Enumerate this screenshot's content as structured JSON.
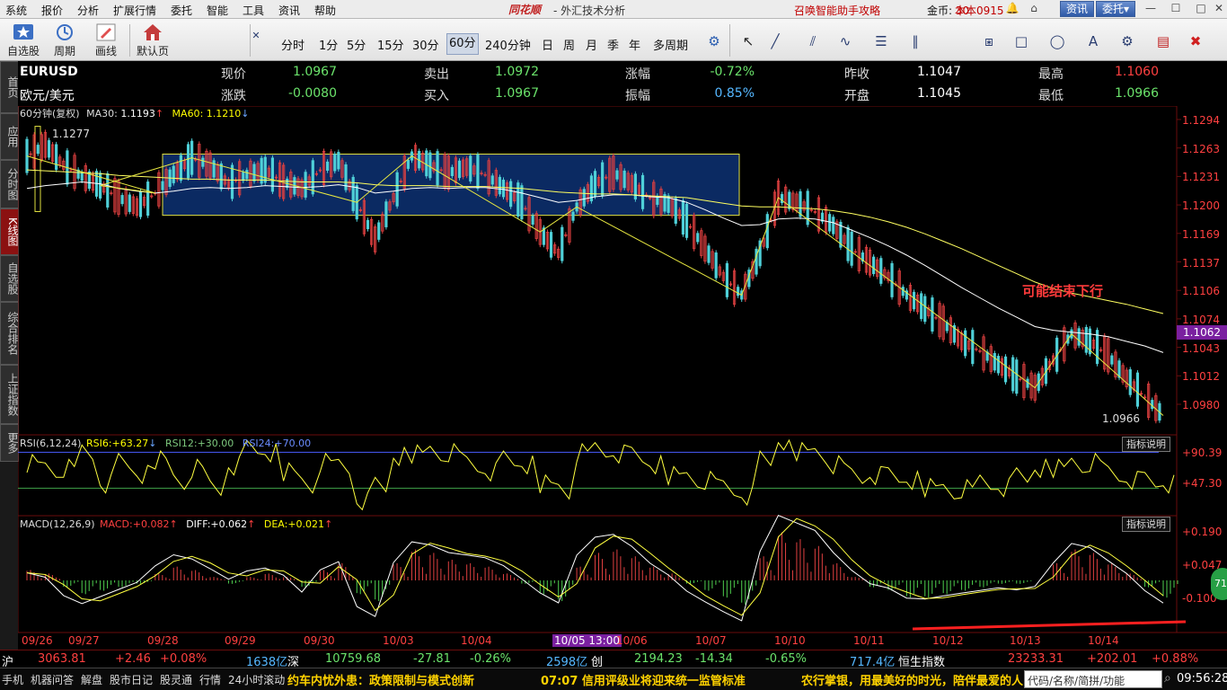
{
  "menu": {
    "items": [
      "系统",
      "报价",
      "分析",
      "扩展行情",
      "委托",
      "智能",
      "工具",
      "资讯",
      "帮助"
    ],
    "brand": "同花顺",
    "brand_subtitle": "- 外汇技术分析",
    "promo": "召唤智能助手攻略",
    "coins_label": "金币:",
    "coins_value": "30",
    "account": "本本0915",
    "btn_info": "资讯",
    "btn_trade": "委托"
  },
  "toolbar": {
    "buttons": [
      {
        "label": "自选股",
        "icon": "star-icon"
      },
      {
        "label": "周期",
        "icon": "cycle-icon"
      },
      {
        "label": "画线",
        "icon": "pen-icon"
      },
      {
        "label": "默认页",
        "icon": "home-icon"
      }
    ],
    "periods": [
      "分时",
      "1分",
      "5分",
      "15分",
      "30分",
      "60分",
      "240分钟",
      "日",
      "周",
      "月",
      "季",
      "年",
      "多周期"
    ],
    "selected_period": "60分",
    "draw_tools": [
      "cursor-icon",
      "line-icon",
      "parallel-icon",
      "wave-icon",
      "fib-icon",
      "bars-icon",
      "channel-icon",
      "rect-icon",
      "ellipse-icon",
      "text-icon",
      "settings-icon",
      "color-icon",
      "delete-icon"
    ]
  },
  "rail": {
    "tabs": [
      {
        "label": "首页",
        "selected": false
      },
      {
        "label": "应用",
        "selected": false
      },
      {
        "label": "分时图",
        "selected": false
      },
      {
        "label": "K线图",
        "selected": true
      },
      {
        "label": "自选股",
        "selected": false
      },
      {
        "label": "综合排名",
        "selected": false
      },
      {
        "label": "上证指数",
        "selected": false
      },
      {
        "label": "更多",
        "selected": false
      }
    ]
  },
  "quote": {
    "symbol": "EURUSD",
    "name": "欧元/美元",
    "rows": [
      {
        "k1": "现价",
        "v1": "1.0967",
        "k2": "卖出",
        "v2": "1.0972",
        "k3": "涨幅",
        "v3": "-0.72%",
        "k4": "昨收",
        "v4": "1.1047",
        "k5": "最高",
        "v5": "1.1060"
      },
      {
        "k1": "涨跌",
        "v1": "-0.0080",
        "k2": "买入",
        "v2": "1.0967",
        "k3": "振幅",
        "v3": "0.85%",
        "k4": "开盘",
        "v4": "1.1045",
        "k5": "最低",
        "v5": "1.0966"
      }
    ]
  },
  "chart_data": [
    {
      "type": "candlestick",
      "title": "60分钟(复权)",
      "indicators": [
        {
          "name": "MA30",
          "value": "1.1193",
          "dir": "↑",
          "color": "#ffffff"
        },
        {
          "name": "MA60",
          "value": "1.1210",
          "dir": "↓",
          "color": "#ffff00"
        }
      ],
      "y_ticks": [
        "1.1294",
        "1.1263",
        "1.1231",
        "1.1200",
        "1.1169",
        "1.1137",
        "1.1106",
        "1.1074",
        "1.1043",
        "1.1012",
        "1.0980"
      ],
      "ylim": [
        1.0955,
        1.13
      ],
      "current_price_label": "1.1062",
      "high_label": "1.1277",
      "low_label": "1.0966",
      "annotation": "可能结束下行",
      "x_ticks": [
        "09/26",
        "09/27",
        "09/28",
        "09/29",
        "09/30",
        "10/03",
        "10/04",
        "10/05 13:00",
        "10/06",
        "10/07",
        "10/10",
        "10/11",
        "10/12",
        "10/13",
        "10/14"
      ],
      "close_series": [
        1.125,
        1.1262,
        1.124,
        1.1228,
        1.1218,
        1.1205,
        1.1195,
        1.121,
        1.123,
        1.1248,
        1.124,
        1.122,
        1.123,
        1.1235,
        1.1222,
        1.1215,
        1.1235,
        1.1245,
        1.12,
        1.116,
        1.1205,
        1.125,
        1.124,
        1.1232,
        1.1238,
        1.123,
        1.1215,
        1.12,
        1.1168,
        1.1145,
        1.1195,
        1.122,
        1.1232,
        1.122,
        1.1205,
        1.1198,
        1.118,
        1.115,
        1.112,
        1.11,
        1.1145,
        1.1205,
        1.12,
        1.119,
        1.1175,
        1.115,
        1.1135,
        1.112,
        1.11,
        1.1085,
        1.107,
        1.105,
        1.104,
        1.1025,
        1.1012,
        1.1,
        1.103,
        1.1058,
        1.105,
        1.1035,
        1.101,
        1.099,
        1.097
      ],
      "ma30_series": [
        1.1215,
        1.1218,
        1.122,
        1.1222,
        1.122,
        1.1215,
        1.1212,
        1.121,
        1.1212,
        1.1215,
        1.1216,
        1.1215,
        1.1216,
        1.1218,
        1.1217,
        1.1216,
        1.1217,
        1.1219,
        1.1216,
        1.121,
        1.1212,
        1.1215,
        1.1216,
        1.1215,
        1.1216,
        1.1216,
        1.1214,
        1.121,
        1.1205,
        1.12,
        1.1202,
        1.1206,
        1.1208,
        1.1208,
        1.1206,
        1.1205,
        1.12,
        1.1192,
        1.1183,
        1.1175,
        1.1176,
        1.1182,
        1.1183,
        1.1182,
        1.1178,
        1.117,
        1.1162,
        1.1153,
        1.1143,
        1.1132,
        1.112,
        1.1108,
        1.1097,
        1.1086,
        1.1076,
        1.1066,
        1.1062,
        1.106,
        1.1058,
        1.1055,
        1.105,
        1.1045,
        1.1038
      ],
      "ma60_series": [
        1.1235,
        1.1234,
        1.1233,
        1.1232,
        1.1231,
        1.1229,
        1.1228,
        1.1227,
        1.1226,
        1.1225,
        1.1225,
        1.1224,
        1.1224,
        1.1224,
        1.1223,
        1.1222,
        1.1222,
        1.1222,
        1.1221,
        1.1219,
        1.1218,
        1.1218,
        1.1218,
        1.1217,
        1.1217,
        1.1217,
        1.1216,
        1.1215,
        1.1213,
        1.1211,
        1.121,
        1.1209,
        1.1209,
        1.1208,
        1.1207,
        1.1206,
        1.1205,
        1.1202,
        1.1199,
        1.1196,
        1.1195,
        1.1195,
        1.1194,
        1.1193,
        1.1191,
        1.1188,
        1.1184,
        1.1179,
        1.1173,
        1.1166,
        1.1158,
        1.115,
        1.1141,
        1.1132,
        1.1123,
        1.1114,
        1.1107,
        1.1102,
        1.1098,
        1.1094,
        1.109,
        1.1085,
        1.108
      ]
    },
    {
      "type": "line",
      "title": "RSI(6,12,24)",
      "indicators": [
        {
          "name": "RSI6",
          "value": "+63.27",
          "dir": "↓",
          "color": "#ffff00"
        },
        {
          "name": "RSI12",
          "value": "+30.00",
          "color": "#7ec97e"
        },
        {
          "name": "RSI24",
          "value": "+70.00",
          "color": "#6a8cff"
        }
      ],
      "y_ticks": [
        "+90.39",
        "+47.30"
      ],
      "button": "指标说明",
      "series": [
        62,
        58,
        55,
        70,
        45,
        60,
        50,
        65,
        48,
        55,
        40,
        60,
        72,
        68,
        55,
        45,
        60,
        58,
        30,
        40,
        65,
        70,
        72,
        68,
        60,
        55,
        62,
        58,
        45,
        40,
        68,
        72,
        70,
        65,
        58,
        52,
        50,
        45,
        40,
        35,
        62,
        78,
        72,
        70,
        58,
        50,
        52,
        48,
        45,
        42,
        40,
        38,
        45,
        42,
        48,
        55,
        58,
        62,
        60,
        52,
        48,
        44,
        42
      ]
    },
    {
      "type": "bar",
      "title": "MACD(12,26,9)",
      "indicators": [
        {
          "name": "MACD",
          "value": "+0.082",
          "dir": "↑",
          "color": "#ff4040"
        },
        {
          "name": "DIFF",
          "value": "+0.062",
          "dir": "↑",
          "color": "#ffffff"
        },
        {
          "name": "DEA",
          "value": "+0.021",
          "dir": "↑",
          "color": "#ffff00"
        }
      ],
      "y_ticks": [
        "+0.190",
        "+0.047",
        "-0.100"
      ],
      "button": "指标说明",
      "values": [
        0.03,
        0.02,
        -0.02,
        -0.04,
        -0.03,
        -0.02,
        -0.01,
        0.02,
        0.04,
        0.03,
        0.01,
        -0.01,
        0.01,
        0.02,
        0.01,
        -0.02,
        0.03,
        0.05,
        -0.04,
        -0.06,
        0.05,
        0.09,
        0.08,
        0.06,
        0.05,
        0.04,
        0.02,
        -0.01,
        -0.04,
        -0.06,
        0.04,
        0.08,
        0.09,
        0.07,
        0.04,
        0.02,
        -0.01,
        -0.03,
        -0.05,
        -0.07,
        0.07,
        0.14,
        0.12,
        0.1,
        0.05,
        0.01,
        -0.02,
        -0.03,
        -0.05,
        -0.05,
        -0.04,
        -0.03,
        -0.02,
        -0.01,
        -0.01,
        0.0,
        0.05,
        0.09,
        0.08,
        0.05,
        0.02,
        -0.02,
        -0.05
      ]
    }
  ],
  "ticker": [
    {
      "label": "沪",
      "price": "3063.81",
      "chg": "+2.46",
      "pct": "+0.08%",
      "vol": "1638亿"
    },
    {
      "label": "深",
      "price": "10759.68",
      "chg": "-27.81",
      "pct": "-0.26%",
      "vol": "2598亿"
    },
    {
      "label": "创",
      "price": "2194.23",
      "chg": "-14.34",
      "pct": "-0.65%",
      "vol": "717.4亿"
    },
    {
      "label": "恒生指数",
      "price": "23233.31",
      "chg": "+202.01",
      "pct": "+0.88%"
    }
  ],
  "status": {
    "tabs": [
      "手机",
      "机器问答",
      "解盘",
      "股市日记",
      "股灵通",
      "行情",
      "24小时滚动"
    ],
    "news": [
      "约车内忧外患：政策限制与模式创新",
      "07:07 信用评级业将迎来统一监管标准",
      "农行掌银，用最美好的时光，陪伴最爱的人"
    ],
    "search_placeholder": "代码/名称/简拼/功能",
    "clock": "09:56:28",
    "badge": "71"
  }
}
